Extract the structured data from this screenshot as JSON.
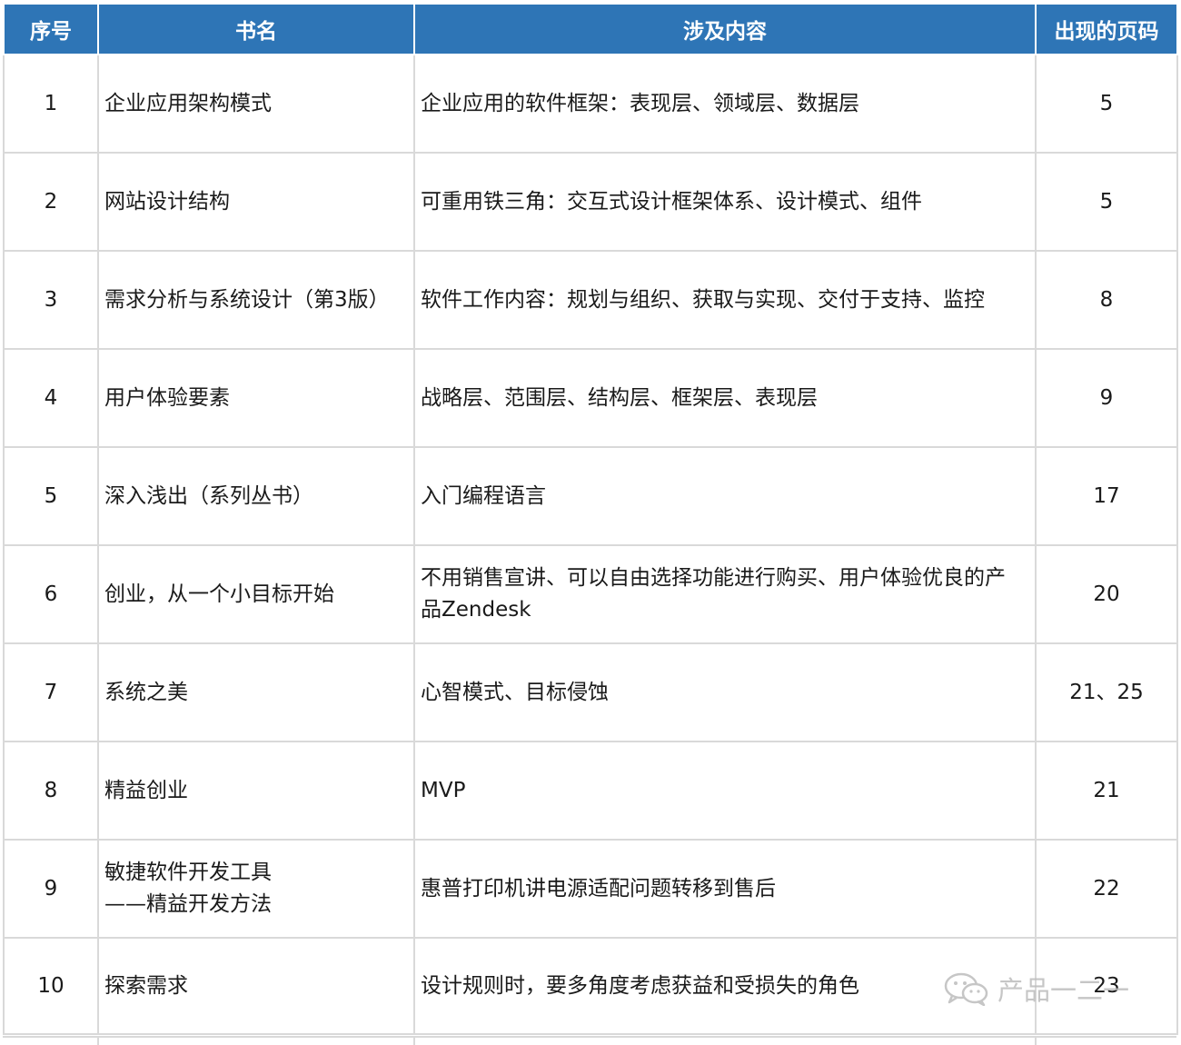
{
  "table": {
    "headers": [
      "序号",
      "书名",
      "涉及内容",
      "出现的页码"
    ],
    "rows": [
      {
        "idx": "1",
        "name": "企业应用架构模式",
        "content": "企业应用的软件框架：表现层、领域层、数据层",
        "page": "5"
      },
      {
        "idx": "2",
        "name": "网站设计结构",
        "content": "可重用铁三角：交互式设计框架体系、设计模式、组件",
        "page": "5"
      },
      {
        "idx": "3",
        "name": "需求分析与系统设计（第3版）",
        "content": "软件工作内容：规划与组织、获取与实现、交付于支持、监控",
        "page": "8"
      },
      {
        "idx": "4",
        "name": "用户体验要素",
        "content": "战略层、范围层、结构层、框架层、表现层",
        "page": "9"
      },
      {
        "idx": "5",
        "name": "深入浅出（系列丛书）",
        "content": "入门编程语言",
        "page": "17"
      },
      {
        "idx": "6",
        "name": "创业，从一个小目标开始",
        "content": "不用销售宣讲、可以自由选择功能进行购买、用户体验优良的产\n品Zendesk",
        "page": "20"
      },
      {
        "idx": "7",
        "name": "系统之美",
        "content": "心智模式、目标侵蚀",
        "page": "21、25"
      },
      {
        "idx": "8",
        "name": "精益创业",
        "content": "MVP",
        "page": "21"
      },
      {
        "idx": "9",
        "name": "敏捷软件开发工具\n——精益开发方法",
        "content": "惠普打印机讲电源适配问题转移到售后",
        "page": "22"
      },
      {
        "idx": "10",
        "name": "探索需求",
        "content": "设计规则时，要多角度考虑获益和受损失的角色",
        "page": "23"
      }
    ]
  },
  "watermark": {
    "text": "产品一二一",
    "icon": "wechat-icon"
  }
}
